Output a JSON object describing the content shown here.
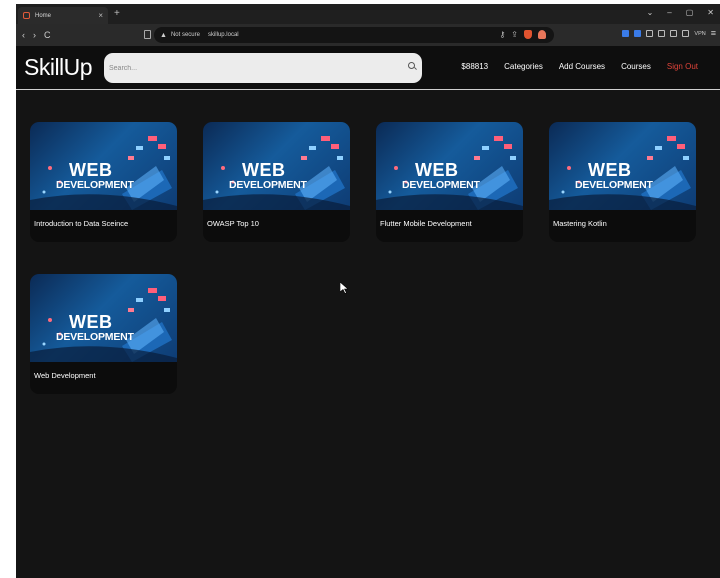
{
  "browser": {
    "tab_title": "Home",
    "tab_close": "×",
    "new_tab": "+",
    "window_controls": [
      "⌄",
      "–",
      "▢",
      "✕"
    ],
    "nav_buttons": [
      "‹",
      "›",
      "C"
    ],
    "not_secure": "Not secure",
    "url": "skillup.local",
    "vpn_label": "VPN",
    "menu_icon": "≡"
  },
  "site": {
    "logo": "SkillUp",
    "search_placeholder": "Search...",
    "nav": {
      "balance": "$88813",
      "categories": "Categories",
      "add_courses": "Add Courses",
      "courses": "Courses",
      "sign_out": "Sign Out"
    }
  },
  "thumbnail": {
    "line1": "WEB",
    "line2": "DEVELOPMENT"
  },
  "courses": [
    {
      "title": "Introduction to Data Sceince"
    },
    {
      "title": "OWASP Top 10"
    },
    {
      "title": "Flutter Mobile Development"
    },
    {
      "title": "Mastering Kotlin"
    },
    {
      "title": "Web Development"
    }
  ],
  "colors": {
    "page_bg": "#141414",
    "card_bg": "#0c0c0c",
    "sign_out": "#e0443a",
    "search_bg": "#ececec"
  }
}
